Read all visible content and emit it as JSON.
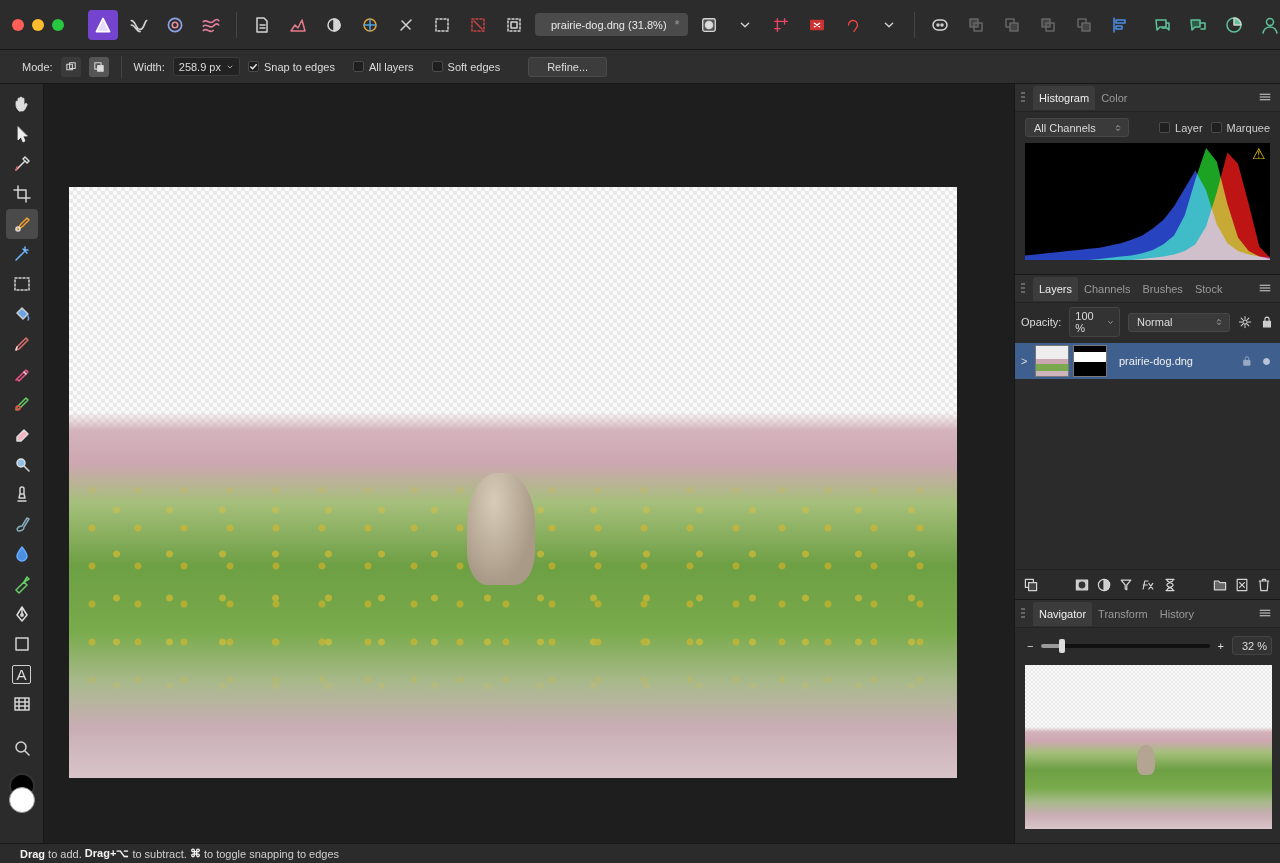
{
  "window": {
    "title": "prairie-dog.dng (31.8%)",
    "modified": "*"
  },
  "traffic_lights": [
    {
      "color": "#ff5f57"
    },
    {
      "color": "#febc2e"
    },
    {
      "color": "#28c840"
    }
  ],
  "personas": [
    {
      "selected": true
    },
    {
      "selected": false
    },
    {
      "selected": false
    },
    {
      "selected": false
    }
  ],
  "context_toolbar": {
    "mode_label": "Mode:",
    "modes": [
      {
        "selected": false
      },
      {
        "selected": true
      }
    ],
    "width_label": "Width:",
    "width_value": "258.9 px",
    "options": [
      {
        "label": "Snap to edges",
        "checked": true
      },
      {
        "label": "All layers",
        "checked": false
      },
      {
        "label": "Soft edges",
        "checked": false
      }
    ],
    "refine_button": "Refine..."
  },
  "tools": [
    {
      "kind": "icon",
      "selected": false
    },
    {
      "kind": "icon",
      "selected": false
    },
    {
      "kind": "icon",
      "selected": false
    },
    {
      "kind": "icon",
      "selected": false
    },
    {
      "kind": "icon",
      "selected": true
    },
    {
      "kind": "icon",
      "selected": false
    },
    {
      "kind": "icon",
      "selected": false
    },
    {
      "kind": "icon",
      "selected": false
    },
    {
      "kind": "icon",
      "selected": false
    },
    {
      "kind": "icon",
      "selected": false
    },
    {
      "kind": "icon",
      "selected": false
    },
    {
      "kind": "icon",
      "selected": false
    },
    {
      "kind": "icon",
      "selected": false
    },
    {
      "kind": "icon",
      "selected": false
    },
    {
      "kind": "icon",
      "selected": false
    },
    {
      "kind": "icon",
      "selected": false
    },
    {
      "kind": "icon",
      "selected": false
    },
    {
      "kind": "icon",
      "selected": false
    },
    {
      "kind": "icon",
      "selected": false
    },
    {
      "kind": "glyph",
      "glyph": "A",
      "selected": false
    },
    {
      "kind": "icon",
      "selected": false
    },
    {
      "kind": "icon",
      "selected": false
    }
  ],
  "colors": {
    "primary": "#000000",
    "secondary": "#ffffff"
  },
  "histogram_panel": {
    "tabs": [
      {
        "label": "Histogram",
        "selected": true
      },
      {
        "label": "Color",
        "selected": false
      }
    ],
    "channel": "All Channels",
    "checks": [
      {
        "label": "Layer",
        "checked": false
      },
      {
        "label": "Marquee",
        "checked": false
      }
    ],
    "warning": "⚠",
    "series": [
      {
        "color": "#2f4fe0",
        "values": [
          4,
          5,
          6,
          7,
          8,
          9,
          10,
          11,
          13,
          15,
          18,
          22,
          28,
          36,
          48,
          64,
          80,
          62,
          32,
          15,
          8,
          5,
          3,
          2
        ]
      },
      {
        "color": "#22c02a",
        "values": [
          0,
          0,
          0,
          0,
          0,
          0,
          0,
          1,
          2,
          3,
          4,
          6,
          9,
          14,
          22,
          40,
          72,
          100,
          88,
          50,
          20,
          8,
          3,
          1
        ]
      },
      {
        "color": "#e01818",
        "values": [
          0,
          0,
          0,
          0,
          0,
          0,
          0,
          0,
          0,
          0,
          0,
          1,
          2,
          3,
          5,
          8,
          14,
          30,
          60,
          96,
          86,
          50,
          12,
          2
        ]
      }
    ]
  },
  "layers_panel": {
    "tabs": [
      {
        "label": "Layers",
        "selected": true
      },
      {
        "label": "Channels",
        "selected": false
      },
      {
        "label": "Brushes",
        "selected": false
      },
      {
        "label": "Stock",
        "selected": false
      }
    ],
    "opacity_label": "Opacity:",
    "opacity": "100 %",
    "blend_mode": "Normal",
    "layers": [
      {
        "name": "prairie-dog.dng",
        "expander": ">",
        "selected": true,
        "expanded": false,
        "locked": true,
        "visible": true
      }
    ]
  },
  "navigator_panel": {
    "tabs": [
      {
        "label": "Navigator",
        "selected": true
      },
      {
        "label": "Transform",
        "selected": false
      },
      {
        "label": "History",
        "selected": false
      }
    ],
    "zoom_out": "−",
    "zoom_in": "+",
    "zoom": "32 %",
    "level": 0.12
  },
  "status_bar": [
    {
      "text": "Drag",
      "bold": true
    },
    {
      "text": " to add. ",
      "bold": false
    },
    {
      "text": "Drag+⌥",
      "bold": true
    },
    {
      "text": " to subtract. ",
      "bold": false
    },
    {
      "text": "⌘",
      "bold": true
    },
    {
      "text": " to toggle snapping to edges",
      "bold": false
    }
  ]
}
